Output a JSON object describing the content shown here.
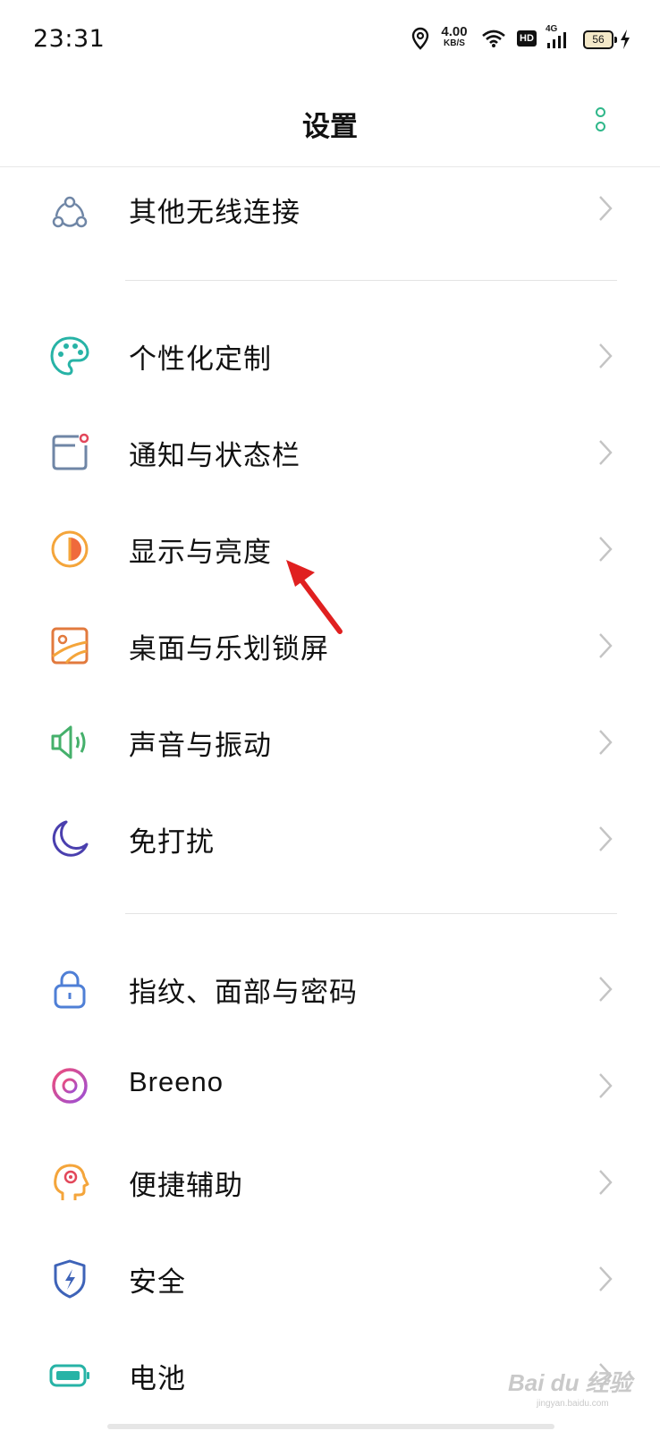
{
  "status_bar": {
    "time": "23:31",
    "net_speed_value": "4.00",
    "net_speed_unit": "KB/S",
    "hd_label": "HD",
    "network_type": "4G",
    "battery_level": "56",
    "icons": [
      "location-icon",
      "wifi-icon",
      "hd-icon",
      "signal-icon",
      "battery-icon",
      "charging-icon"
    ]
  },
  "header": {
    "title": "设置",
    "more_icon": "more-vertical-icon",
    "accent_color": "#2fb78a"
  },
  "items": [
    {
      "label": "其他无线连接",
      "icon": "wireless-connection-icon"
    },
    {
      "label": "个性化定制",
      "icon": "palette-icon"
    },
    {
      "label": "通知与状态栏",
      "icon": "notification-icon"
    },
    {
      "label": "显示与亮度",
      "icon": "brightness-icon"
    },
    {
      "label": "桌面与乐划锁屏",
      "icon": "wallpaper-icon"
    },
    {
      "label": "声音与振动",
      "icon": "speaker-icon"
    },
    {
      "label": "免打扰",
      "icon": "moon-icon"
    },
    {
      "label": "指纹、面部与密码",
      "icon": "lock-icon"
    },
    {
      "label": "Breeno",
      "icon": "breeno-icon"
    },
    {
      "label": "便捷辅助",
      "icon": "assistant-icon"
    },
    {
      "label": "安全",
      "icon": "shield-icon"
    },
    {
      "label": "电池",
      "icon": "battery-setting-icon"
    }
  ],
  "watermark": {
    "text": "Bai du 经验",
    "sub": "jingyan.baidu.com"
  }
}
